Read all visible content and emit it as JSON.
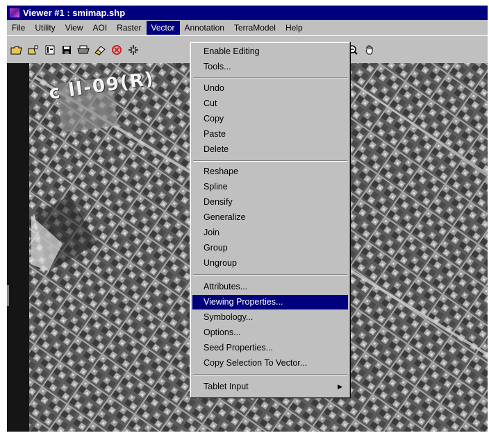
{
  "window": {
    "title": "Viewer #1 : smimap.shp"
  },
  "menubar": {
    "items": [
      {
        "label": "File"
      },
      {
        "label": "Utility"
      },
      {
        "label": "View"
      },
      {
        "label": "AOI"
      },
      {
        "label": "Raster"
      },
      {
        "label": "Vector"
      },
      {
        "label": "Annotation"
      },
      {
        "label": "TerraModel"
      },
      {
        "label": "Help"
      }
    ],
    "active": "Vector"
  },
  "map": {
    "overlay_text": "c ll-09(R)"
  },
  "vector_menu": {
    "items": [
      {
        "label": "Enable Editing"
      },
      {
        "label": "Tools..."
      },
      {
        "label": "Undo"
      },
      {
        "label": "Cut"
      },
      {
        "label": "Copy"
      },
      {
        "label": "Paste"
      },
      {
        "label": "Delete"
      },
      {
        "label": "Reshape"
      },
      {
        "label": "Spline"
      },
      {
        "label": "Densify"
      },
      {
        "label": "Generalize"
      },
      {
        "label": "Join"
      },
      {
        "label": "Group"
      },
      {
        "label": "Ungroup"
      },
      {
        "label": "Attributes..."
      },
      {
        "label": "Viewing Properties..."
      },
      {
        "label": "Symbology..."
      },
      {
        "label": "Options..."
      },
      {
        "label": "Seed Properties..."
      },
      {
        "label": "Copy Selection To Vector..."
      },
      {
        "label": "Tablet Input"
      }
    ],
    "highlighted": "Viewing Properties..."
  },
  "toolbar": {
    "icons": [
      "open-folder-icon",
      "new-layer-icon",
      "info-icon",
      "save-icon",
      "print-icon",
      "eraser-icon",
      "close-circle-icon",
      "crosshair-icon",
      "zoom-out-icon",
      "pan-hand-icon"
    ]
  },
  "colors": {
    "titlebar": "#00007f",
    "highlight": "#00007f",
    "chrome": "#c0c0c0"
  }
}
